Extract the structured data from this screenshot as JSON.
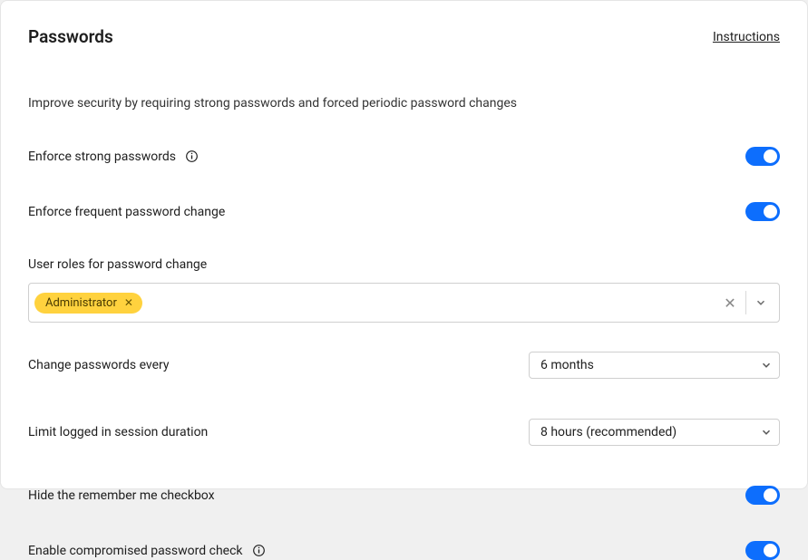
{
  "header": {
    "title": "Passwords",
    "instructions_link": "Instructions"
  },
  "description": "Improve security by requiring strong passwords and forced periodic password changes",
  "settings": {
    "enforce_strong": {
      "label": "Enforce strong passwords",
      "checked": true
    },
    "enforce_frequent": {
      "label": "Enforce frequent password change",
      "checked": true
    },
    "user_roles": {
      "label": "User roles for password change",
      "tags": [
        "Administrator"
      ]
    },
    "change_every": {
      "label": "Change passwords every",
      "value": "6 months"
    },
    "session_duration": {
      "label": "Limit logged in session duration",
      "value": "8 hours (recommended)"
    },
    "hide_remember": {
      "label": "Hide the remember me checkbox",
      "checked": true
    },
    "compromised_check": {
      "label": "Enable compromised password check",
      "checked": true
    }
  }
}
